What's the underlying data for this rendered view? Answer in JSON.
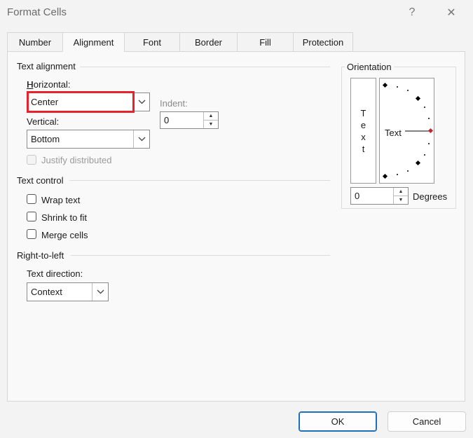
{
  "window": {
    "title": "Format Cells",
    "help_label": "?",
    "close_label": "✕"
  },
  "tabs": [
    "Number",
    "Alignment",
    "Font",
    "Border",
    "Fill",
    "Protection"
  ],
  "text_alignment": {
    "group_label": "Text alignment",
    "horizontal_label": "Horizontal:",
    "horizontal_value": "Center",
    "vertical_label": "Vertical:",
    "vertical_value": "Bottom",
    "indent_label": "Indent:",
    "indent_value": "0",
    "justify_distributed_label": "Justify distributed"
  },
  "text_control": {
    "group_label": "Text control",
    "wrap_text": "Wrap text",
    "shrink_to_fit": "Shrink to fit",
    "merge_cells": "Merge cells"
  },
  "rtl": {
    "group_label": "Right-to-left",
    "direction_label": "Text direction:",
    "direction_value": "Context"
  },
  "orientation": {
    "group_label": "Orientation",
    "vertical_text": [
      "T",
      "e",
      "x",
      "t"
    ],
    "dial_text": "Text",
    "degrees_value": "0",
    "degrees_label": "Degrees"
  },
  "buttons": {
    "ok": "OK",
    "cancel": "Cancel"
  },
  "colors": {
    "highlight": "#e8222c",
    "dial_marker": "#c0272d",
    "default_button": "#1f6fb8"
  }
}
